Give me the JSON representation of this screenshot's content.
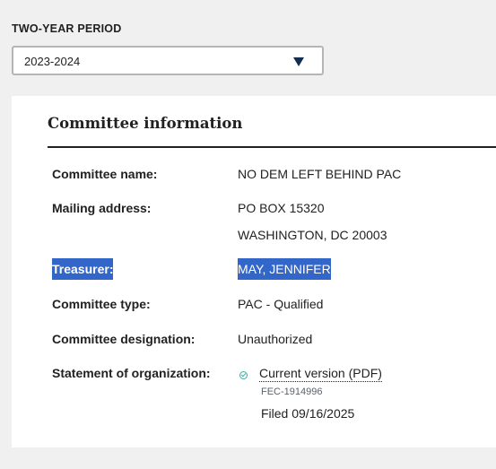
{
  "period": {
    "label": "TWO-YEAR PERIOD",
    "selected": "2023-2024"
  },
  "committee": {
    "title": "Committee information",
    "name_label": "Committee name:",
    "name_value": "NO DEM LEFT BEHIND PAC",
    "address_label": "Mailing address:",
    "address_line1": "PO BOX 15320",
    "address_line2": "WASHINGTON, DC 20003",
    "treasurer_label": "Treasurer:",
    "treasurer_value": "MAY, JENNIFER",
    "type_label": "Committee type:",
    "type_value": "PAC - Qualified",
    "designation_label": "Committee designation:",
    "designation_value": "Unauthorized",
    "statement_label": "Statement of organization:",
    "statement_link": "Current version (PDF)",
    "statement_id": "FEC-1914996",
    "statement_filed": "Filed 09/16/2025"
  },
  "colors": {
    "page_background": "#f0f0f0",
    "selection_highlight": "#3266c8",
    "caret": "#112e51",
    "status_icon": "#2fb4a4"
  },
  "icons": {
    "select_caret": "caret-down-icon",
    "status": "check-circle-icon"
  }
}
